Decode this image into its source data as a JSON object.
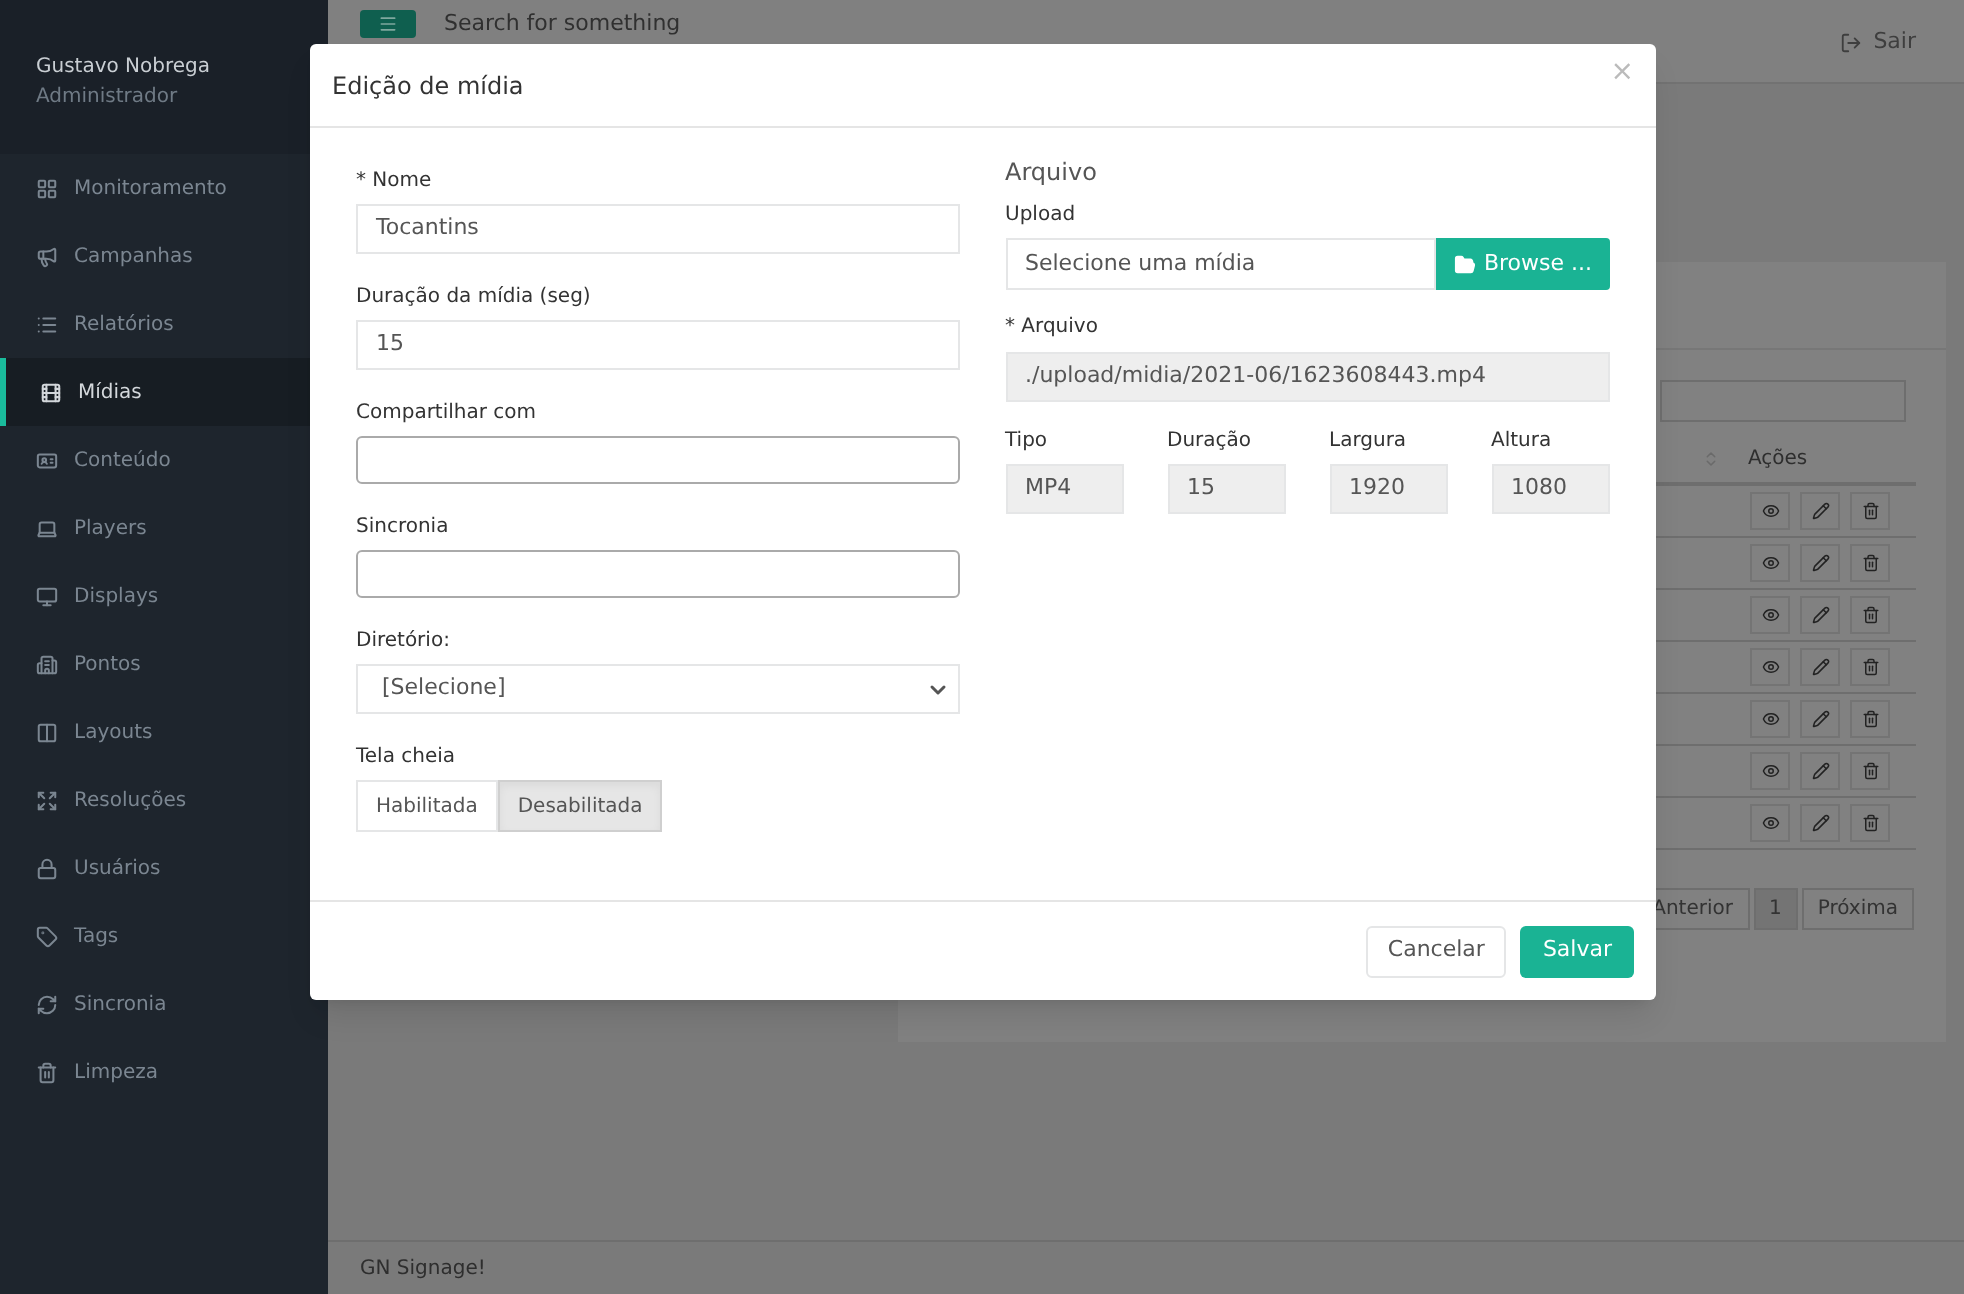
{
  "sidebar": {
    "user": {
      "name": "Gustavo Nobrega",
      "role": "Administrador"
    },
    "items": [
      {
        "label": "Monitoramento",
        "selected": false
      },
      {
        "label": "Campanhas",
        "selected": false
      },
      {
        "label": "Relatórios",
        "selected": false
      },
      {
        "label": "Mídias",
        "selected": true
      },
      {
        "label": "Conteúdo",
        "selected": false
      },
      {
        "label": "Players",
        "selected": false
      },
      {
        "label": "Displays",
        "selected": false
      },
      {
        "label": "Pontos",
        "selected": false
      },
      {
        "label": "Layouts",
        "selected": false
      },
      {
        "label": "Resoluções",
        "selected": false
      },
      {
        "label": "Usuários",
        "selected": false
      },
      {
        "label": "Tags",
        "selected": false
      },
      {
        "label": "Sincronia",
        "selected": false
      },
      {
        "label": "Limpeza",
        "selected": false
      }
    ]
  },
  "topbar": {
    "search": {
      "placeholder": "Search for something"
    },
    "logout": "Sair"
  },
  "table": {
    "action_header": "Ações"
  },
  "pagination": [
    {
      "label": "Anterior",
      "selected": false
    },
    {
      "label": "1",
      "selected": true
    },
    {
      "label": "Próxima",
      "selected": false
    }
  ],
  "footer": "GN Signage!",
  "modal": {
    "title": "Edição de mídia",
    "close": "×",
    "left_fields": [
      {
        "kind": "text",
        "label": "* Nome",
        "value": "Tocantins"
      },
      {
        "kind": "text",
        "label": "Duração da mídia (seg)",
        "value": "15"
      },
      {
        "kind": "tags",
        "label": "Compartilhar com"
      },
      {
        "kind": "tags",
        "label": "Sincronia"
      },
      {
        "kind": "select",
        "label": "Diretório:",
        "value": "[Selecione]"
      },
      {
        "kind": "toggle",
        "label": "Tela cheia",
        "options": [
          {
            "label": "Habilitada",
            "selected": false
          },
          {
            "label": "Desabilitada",
            "selected": true
          }
        ]
      }
    ],
    "file": {
      "section": "Arquivo",
      "upload_label": "Upload",
      "upload_placeholder": "Selecione uma mídia",
      "browse": "Browse ...",
      "path_label": "* Arquivo",
      "path": "./upload/midia/2021-06/1623608443.mp4",
      "meta": [
        {
          "label": "Tipo",
          "value": "MP4"
        },
        {
          "label": "Duração",
          "value": "15"
        },
        {
          "label": "Largura",
          "value": "1920"
        },
        {
          "label": "Altura",
          "value": "1080"
        }
      ]
    },
    "buttons": [
      {
        "label": "Cancelar",
        "kind": "default"
      },
      {
        "label": "Salvar",
        "kind": "primary"
      }
    ]
  }
}
